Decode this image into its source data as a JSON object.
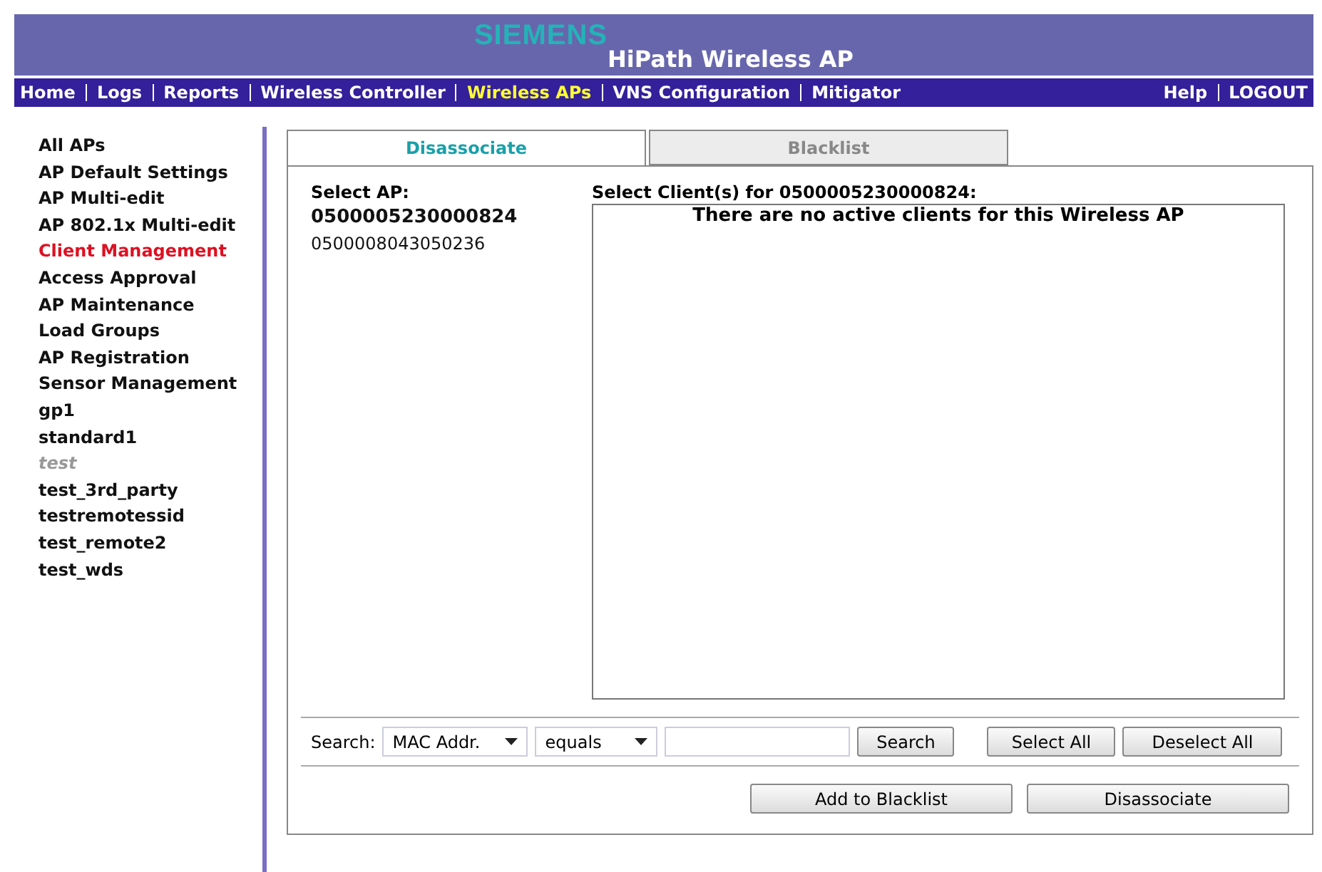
{
  "header": {
    "brand": "SIEMENS",
    "product": "HiPath Wireless AP"
  },
  "nav": {
    "items": [
      {
        "label": "Home",
        "selected": false
      },
      {
        "label": "Logs",
        "selected": false
      },
      {
        "label": "Reports",
        "selected": false
      },
      {
        "label": "Wireless Controller",
        "selected": false
      },
      {
        "label": "Wireless APs",
        "selected": true
      },
      {
        "label": "VNS Configuration",
        "selected": false
      },
      {
        "label": "Mitigator",
        "selected": false
      }
    ],
    "right_items": [
      {
        "label": "Help"
      },
      {
        "label": "LOGOUT"
      }
    ]
  },
  "sidebar": {
    "items": [
      {
        "label": "All APs",
        "selected": false,
        "disabled": false
      },
      {
        "label": "AP Default Settings",
        "selected": false,
        "disabled": false
      },
      {
        "label": "AP Multi-edit",
        "selected": false,
        "disabled": false
      },
      {
        "label": "AP 802.1x Multi-edit",
        "selected": false,
        "disabled": false
      },
      {
        "label": "Client Management",
        "selected": true,
        "disabled": false
      },
      {
        "label": "Access Approval",
        "selected": false,
        "disabled": false
      },
      {
        "label": "AP Maintenance",
        "selected": false,
        "disabled": false
      },
      {
        "label": "Load Groups",
        "selected": false,
        "disabled": false
      },
      {
        "label": "AP Registration",
        "selected": false,
        "disabled": false
      },
      {
        "label": "Sensor Management",
        "selected": false,
        "disabled": false
      },
      {
        "label": "gp1",
        "selected": false,
        "disabled": false
      },
      {
        "label": "standard1",
        "selected": false,
        "disabled": false
      },
      {
        "label": "test",
        "selected": false,
        "disabled": true
      },
      {
        "label": "test_3rd_party",
        "selected": false,
        "disabled": false
      },
      {
        "label": "testremotessid",
        "selected": false,
        "disabled": false
      },
      {
        "label": "test_remote2",
        "selected": false,
        "disabled": false
      },
      {
        "label": "test_wds",
        "selected": false,
        "disabled": false
      }
    ]
  },
  "tabs": [
    {
      "label": "Disassociate",
      "selected": true
    },
    {
      "label": "Blacklist",
      "selected": false
    }
  ],
  "ap_list": {
    "label": "Select AP:",
    "items": [
      {
        "label": "0500005230000824",
        "selected": true
      },
      {
        "label": "0500008043050236",
        "selected": false
      }
    ]
  },
  "clients": {
    "label": "Select Client(s) for 0500005230000824:",
    "empty_message": "There are no active clients for this Wireless AP"
  },
  "search": {
    "label": "Search:",
    "field": "MAC Addr.",
    "operator": "equals",
    "button": "Search"
  },
  "buttons": {
    "select_all": "Select All",
    "deselect_all": "Deselect All",
    "add_to_blacklist": "Add to Blacklist",
    "disassociate": "Disassociate"
  }
}
